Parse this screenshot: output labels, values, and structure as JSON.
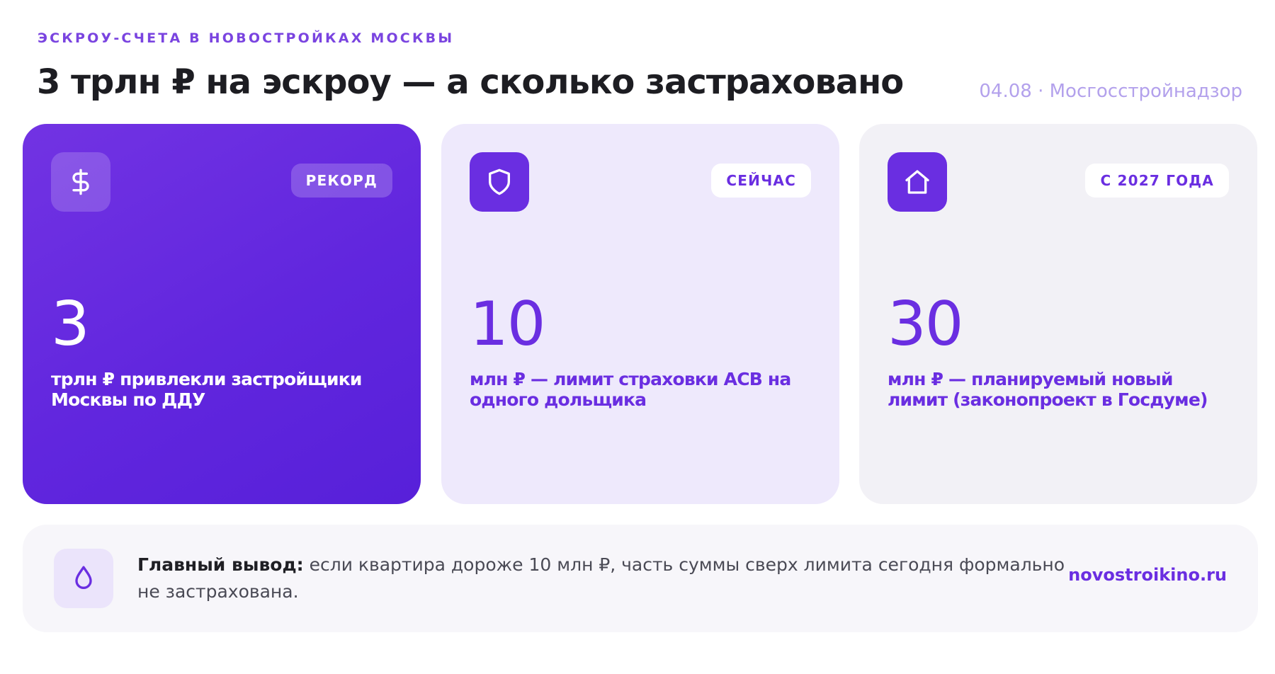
{
  "header": {
    "kicker": "ЭСКРОУ-СЧЕТА В НОВОСТРОЙКАХ МОСКВЫ",
    "title": "3 трлн ₽ на эскроу — а сколько застраховано",
    "source": "04.08 · Мосгосстройнадзор"
  },
  "cards": [
    {
      "icon": "dollar-icon",
      "badge": "РЕКОРД",
      "value": "3",
      "description": "трлн ₽ привлекли застройщики Москвы по ДДУ"
    },
    {
      "icon": "shield-icon",
      "badge": "СЕЙЧАС",
      "value": "10",
      "description": "млн ₽ — лимит страховки АСВ на одного дольщика"
    },
    {
      "icon": "house-icon",
      "badge": "С 2027 ГОДА",
      "value": "30",
      "description": "млн ₽ — планируемый новый лимит (законопроект в Госдуме)"
    }
  ],
  "footer": {
    "icon": "droplet-icon",
    "label": "Главный вывод:",
    "text": " если квартира дороже 10 млн ₽, часть суммы сверх лимита сегодня формально не застрахована.",
    "site": "novostroikino.ru"
  },
  "colors": {
    "accent": "#6a2ee1",
    "card1_bg": "#6126de",
    "card2_bg": "#eee9fc",
    "card3_bg": "#f2f1f6",
    "kicker": "#7a44e0",
    "source": "#b3a1ec"
  }
}
